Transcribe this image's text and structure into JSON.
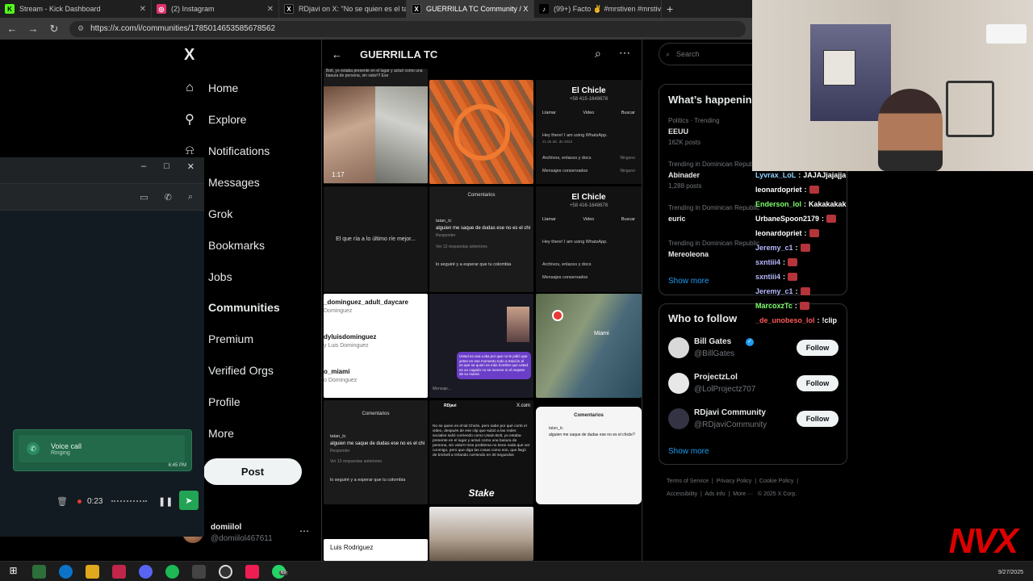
{
  "browser": {
    "tabs": [
      {
        "label": "Stream - Kick Dashboard",
        "icon": "kick-icon",
        "color": "#53fc18",
        "active": false
      },
      {
        "label": "(2) Instagram",
        "icon": "instagram-icon",
        "color": "#e1306c",
        "active": false
      },
      {
        "label": "RDjavi on X: \"No se quien es el ta",
        "icon": "x-logo-icon",
        "color": "#ffffff",
        "active": false
      },
      {
        "label": "GUERRILLA TC Community / X",
        "icon": "x-logo-icon",
        "color": "#ffffff",
        "active": true
      },
      {
        "label": "(99+) Facto ✌️ #mrstiven #mrstiv",
        "icon": "tiktok-icon",
        "color": "#ffffff",
        "active": false
      }
    ],
    "new_tab": "+",
    "url": "https://x.com/i/communities/1785014653585678562"
  },
  "x_nav": {
    "logo": "X",
    "items": [
      {
        "label": "Home",
        "icon": "home-icon",
        "glyph": "⌂",
        "bold": false
      },
      {
        "label": "Explore",
        "icon": "search-icon",
        "glyph": "⚲",
        "bold": false
      },
      {
        "label": "Notifications",
        "icon": "bell-icon",
        "glyph": "⍾",
        "bold": false
      },
      {
        "label": "Messages",
        "icon": "mail-icon",
        "glyph": "✉",
        "bold": false
      },
      {
        "label": "Grok",
        "icon": "grok-icon",
        "glyph": "▧",
        "bold": false
      },
      {
        "label": "Bookmarks",
        "icon": "bookmark-icon",
        "glyph": "⚑",
        "bold": false
      },
      {
        "label": "Jobs",
        "icon": "briefcase-icon",
        "glyph": "▤",
        "bold": false
      },
      {
        "label": "Communities",
        "icon": "people-icon",
        "glyph": "⚇",
        "bold": true
      },
      {
        "label": "Premium",
        "icon": "premium-icon",
        "glyph": "X",
        "bold": false
      },
      {
        "label": "Verified Orgs",
        "icon": "lightning-icon",
        "glyph": "⚡",
        "bold": false
      },
      {
        "label": "Profile",
        "icon": "person-icon",
        "glyph": "☺",
        "bold": false
      },
      {
        "label": "More",
        "icon": "more-circle-icon",
        "glyph": "⋯",
        "bold": false
      }
    ],
    "post_label": "Post",
    "account": {
      "name": "domiilol",
      "handle": "@domiilol467611",
      "more": "⋯"
    }
  },
  "whatsapp": {
    "window_controls": [
      "–",
      "□",
      "✕"
    ],
    "voice_call": {
      "title": "Voice call",
      "status": "Ringing",
      "time": "6:45 PM"
    },
    "recording": {
      "timer": "0:23"
    },
    "badge": "69"
  },
  "community": {
    "title": "GUERRILLA TC",
    "media": {
      "c1_time": "1:17",
      "c1_caption": "Bolt, yo estaba presente en el lugar y actuó como una basura de persona, sin valor!!! Ese",
      "chicle_name": "El Chicle",
      "chicle_phone_1": "+58 415-1648678",
      "chicle_phone_2": "+58 416-1648678",
      "chicle_actions": [
        "Llamar",
        "Video",
        "Buscar"
      ],
      "chicle_status": "Hey there! I am using WhatsApp.",
      "chicle_date": "21 de dic. de 2023",
      "chicle_archive": "Archivos, enlaces y docs",
      "chicle_archive_val": "Ninguno",
      "chicle_saved": "Mensajes conservados",
      "chicle_saved_val": "Ninguno",
      "black_text": "El que ría a lo último ríe mejor...",
      "comments_title": "Comentarios",
      "comment_user": "tatan_tc",
      "comment_time": "7 min",
      "comment_text": "alguien me saque de dudas ese no es el chi",
      "comment_reply": "Responder",
      "comment_more": "Ver 13 respuestas anteriores",
      "reply_time": "4 min",
      "reply_text": "lo seguiré y a esperar que tu colombia",
      "follow_list": [
        {
          "name": "_dominguez_adult_daycare",
          "sub": "Dominguez"
        },
        {
          "name": "dyluisdominguez",
          "sub": "y Luis Dominguez"
        },
        {
          "name": "o_miami",
          "sub": "o Dominguez"
        }
      ],
      "dm_text": "Usted es una Loka por que no le pidió que yeten en ese momento todo a traición al es que se quien es más hombre que usted es un cagado no se merece ni el respeto de su mamá",
      "dm_input": "Mensaje...",
      "map_label": "Miami",
      "tweet_user": "RDjavi",
      "tweet_site": "X.com",
      "tweet_text": "No se quien es el tal Chicle, pero sabe por qué cortó el video, después de ese clip que subió a las redes sociales salió corriendo como Usain Bolt, yo estaba presente en el lugar y actuó como una basura de persona, sin valor!!! Ese problema no tiene nada que ver conmigo, pero que diga las cosas como son, que llegó de brickell a Orlando corriendo en 30 segundos",
      "stake": "Stake",
      "ig_comment": "alguien me saque de dudas ese no es el chicle?",
      "profile_name": "Luis Rodriguez"
    }
  },
  "sidebar_right": {
    "search_placeholder": "Search",
    "trends_title": "What’s happenin",
    "trends": [
      {
        "context": "Politics · Trending",
        "name": "EEUU",
        "count": "162K posts"
      },
      {
        "context": "Trending in Dominican Repub",
        "name": "Abinader",
        "count": "1,288 posts"
      },
      {
        "context": "Trending in Dominican Republic",
        "name": "euric",
        "count": ""
      },
      {
        "context": "Trending in Dominican Republic",
        "name": "Mereoleona",
        "count": ""
      }
    ],
    "show_more": "Show more",
    "wtf_title": "Who to follow",
    "follow_label": "Follow",
    "suggestions": [
      {
        "name": "Bill Gates",
        "handle": "@BillGates",
        "verified": true
      },
      {
        "name": "ProjectzLol",
        "handle": "@LolProjectz707",
        "verified": false
      },
      {
        "name": "RDjavi Community",
        "handle": "@RDjaviCommunity",
        "verified": false
      }
    ],
    "footer": [
      "Terms of Service",
      "Privacy Policy",
      "Cookie Policy",
      "Accessibility",
      "Ads info",
      "More ···",
      "© 2025 X Corp."
    ]
  },
  "stream_chat": [
    {
      "user": "Lyvrax_LoL",
      "msg": "JAJAJjajajja",
      "color": "#8fd3ff"
    },
    {
      "user": "leonardopriet",
      "msg": "",
      "color": "#ffffff"
    },
    {
      "user": "Enderson_lol",
      "msg": "Kakakakak",
      "color": "#7dff6a"
    },
    {
      "user": "UrbaneSpoon2179",
      "msg": "",
      "color": "#ffffff"
    },
    {
      "user": "leonardopriet",
      "msg": "",
      "color": "#ffffff"
    },
    {
      "user": "Jeremy_c1",
      "msg": "",
      "color": "#b7b9ff"
    },
    {
      "user": "sxntiii4",
      "msg": "",
      "color": "#b7b9ff"
    },
    {
      "user": "sxntiii4",
      "msg": "",
      "color": "#b7b9ff"
    },
    {
      "user": "Jeremy_c1",
      "msg": "",
      "color": "#b7b9ff"
    },
    {
      "user": "MarcoxzTc",
      "msg": "",
      "color": "#7dff6a"
    },
    {
      "user": "_de_unobeso_lol",
      "msg": "!clip",
      "color": "#ff5a5a"
    }
  ],
  "overlay": {
    "logo": "NVX"
  },
  "taskbar": {
    "date": "9/27/2025"
  }
}
